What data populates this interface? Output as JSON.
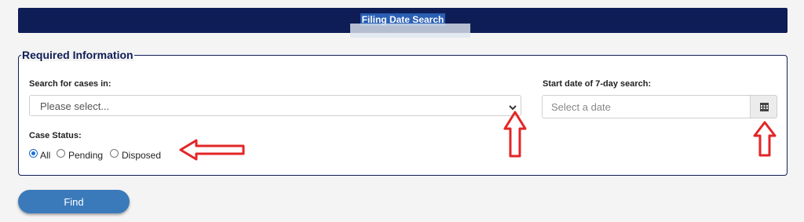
{
  "header": {
    "title": "Filing Date Search"
  },
  "form": {
    "legend": "Required Information",
    "search_cases_label": "Search for cases in:",
    "search_cases_value": "Please select...",
    "start_date_label": "Start date of 7-day search:",
    "start_date_placeholder": "Select a date",
    "case_status_label": "Case Status:",
    "case_status_options": [
      "All",
      "Pending",
      "Disposed"
    ],
    "case_status_selected": "All"
  },
  "actions": {
    "find_label": "Find"
  },
  "icons": {
    "dropdown": "chevron-down-icon",
    "calendar": "calendar-icon",
    "annotation": "red-arrow"
  },
  "colors": {
    "header_bg": "#0f1d57",
    "button_bg": "#3a7abb",
    "annotation": "#e32626",
    "radio_selected": "#1a6fd1"
  }
}
